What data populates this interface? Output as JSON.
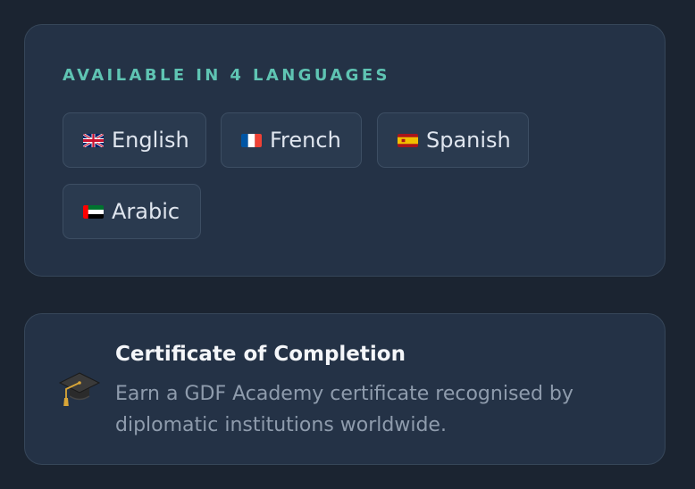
{
  "languages": {
    "heading": "AVAILABLE IN 4 LANGUAGES",
    "items": [
      {
        "label": "English",
        "flag": "uk-flag-icon"
      },
      {
        "label": "French",
        "flag": "france-flag-icon"
      },
      {
        "label": "Spanish",
        "flag": "spain-flag-icon"
      },
      {
        "label": "Arabic",
        "flag": "uae-flag-icon"
      }
    ]
  },
  "certificate": {
    "icon": "graduation-cap-icon",
    "title": "Certificate of Completion",
    "description": "Earn a GDF Academy certificate recognised by diplomatic institutions worldwide."
  },
  "colors": {
    "background": "#1b2431",
    "card": "#243246",
    "accent": "#5fc4b3",
    "chip": "#2a3a4f",
    "title_text": "#f4f6f9",
    "muted_text": "#8f9cad"
  }
}
